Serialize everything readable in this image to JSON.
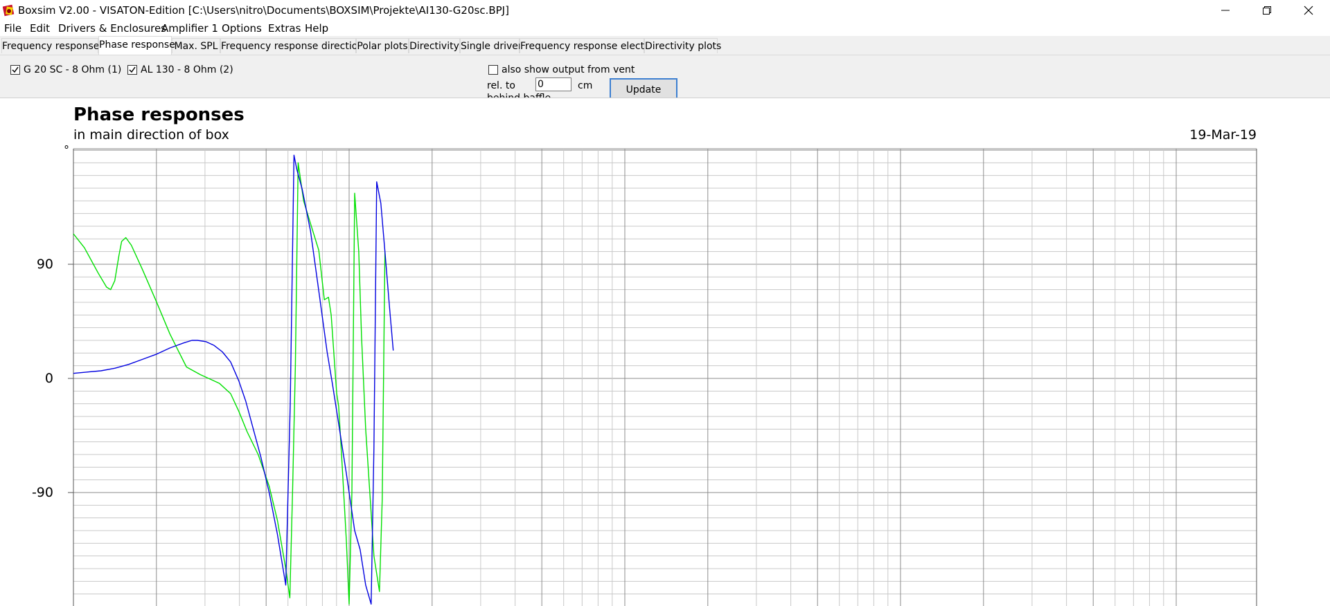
{
  "window": {
    "title": "Boxsim V2.00 - VISATON-Edition [C:\\Users\\nitro\\Documents\\BOXSIM\\Projekte\\AI130-G20sc.BPJ]",
    "icon": "boxsim-app-icon"
  },
  "menu": {
    "items": [
      "File",
      "Edit",
      "Drivers & Enclosures",
      "Amplifier 1",
      "Options",
      "Extras",
      "Help"
    ]
  },
  "tabs": [
    {
      "label": "Frequency response.",
      "active": false
    },
    {
      "label": "Phase response",
      "active": true
    },
    {
      "label": "Max. SPL",
      "active": false
    },
    {
      "label": "Frequency response directions",
      "active": false
    },
    {
      "label": "Polar plots",
      "active": false
    },
    {
      "label": "Directivity",
      "active": false
    },
    {
      "label": "Single driver",
      "active": false
    },
    {
      "label": "Frequency response electr..",
      "active": false
    },
    {
      "label": "Directivity plots",
      "active": false
    }
  ],
  "controls": {
    "driver1": {
      "label": "G 20 SC - 8 Ohm (1)",
      "checked": true
    },
    "driver2": {
      "label": "AL 130 - 8 Ohm (2)",
      "checked": true
    },
    "vent": {
      "label": "also show output from vent",
      "checked": false
    },
    "rel_to_label": "rel. to",
    "rel_to_value": "0",
    "unit_label": "cm",
    "behind_label": "behind baffle",
    "update_label": "Update graphs"
  },
  "chart_data": {
    "type": "line",
    "title": "Phase responses",
    "subtitle": "in main direction of box",
    "date": "19-Mar-19",
    "ylabel": "°",
    "yticks": [
      "90",
      "0",
      "-90"
    ],
    "ylim": [
      -178,
      180
    ],
    "xscale": "log",
    "xlim_decades": 3,
    "grid": true,
    "colors": {
      "G 20 SC - 8 Ohm (1)": "#00e000",
      "AL 130 - 8 Ohm (2)": "#0000e0"
    },
    "series": [
      {
        "name": "G 20 SC - 8 Ohm (1)",
        "color": "#00e000",
        "points": [
          [
            0,
            114
          ],
          [
            0.04,
            103
          ],
          [
            0.09,
            83
          ],
          [
            0.12,
            72
          ],
          [
            0.135,
            70
          ],
          [
            0.15,
            77
          ],
          [
            0.165,
            97
          ],
          [
            0.175,
            108
          ],
          [
            0.19,
            111
          ],
          [
            0.21,
            105
          ],
          [
            0.25,
            86
          ],
          [
            0.3,
            61
          ],
          [
            0.35,
            35
          ],
          [
            0.38,
            22
          ],
          [
            0.41,
            9
          ],
          [
            0.46,
            3
          ],
          [
            0.5,
            -1
          ],
          [
            0.53,
            -4
          ],
          [
            0.57,
            -12
          ],
          [
            0.6,
            -26
          ],
          [
            0.63,
            -42
          ],
          [
            0.67,
            -60
          ],
          [
            0.71,
            -85
          ],
          [
            0.74,
            -112
          ],
          [
            0.77,
            -150
          ],
          [
            0.785,
            -173
          ],
          [
            0.795,
            -88
          ],
          [
            0.805,
            10
          ],
          [
            0.815,
            170
          ],
          [
            0.835,
            140
          ],
          [
            0.86,
            122
          ],
          [
            0.89,
            101
          ],
          [
            0.91,
            62
          ],
          [
            0.925,
            64
          ],
          [
            0.935,
            50
          ],
          [
            0.95,
            3
          ],
          [
            0.955,
            -12
          ],
          [
            0.962,
            -22
          ],
          [
            0.975,
            -70
          ],
          [
            0.99,
            -128
          ],
          [
            1.0,
            -178
          ],
          [
            1.01,
            -90
          ],
          [
            1.02,
            146
          ],
          [
            1.035,
            100
          ],
          [
            1.045,
            33
          ],
          [
            1.06,
            -40
          ],
          [
            1.09,
            -140
          ],
          [
            1.11,
            -168
          ],
          [
            1.12,
            -95
          ],
          [
            1.13,
            100
          ]
        ]
      },
      {
        "name": "AL 130 - 8 Ohm (2)",
        "color": "#0000e0",
        "points": [
          [
            0,
            4
          ],
          [
            0.05,
            5
          ],
          [
            0.1,
            6
          ],
          [
            0.15,
            8
          ],
          [
            0.2,
            11
          ],
          [
            0.25,
            15
          ],
          [
            0.3,
            19
          ],
          [
            0.35,
            24
          ],
          [
            0.4,
            28
          ],
          [
            0.43,
            30
          ],
          [
            0.45,
            30
          ],
          [
            0.48,
            29
          ],
          [
            0.51,
            26
          ],
          [
            0.54,
            21
          ],
          [
            0.57,
            13
          ],
          [
            0.6,
            -2
          ],
          [
            0.625,
            -18
          ],
          [
            0.65,
            -38
          ],
          [
            0.68,
            -62
          ],
          [
            0.71,
            -90
          ],
          [
            0.74,
            -123
          ],
          [
            0.77,
            -163
          ],
          [
            0.7865,
            -20
          ],
          [
            0.8,
            176
          ],
          [
            0.81,
            165
          ],
          [
            0.83,
            149
          ],
          [
            0.86,
            116
          ],
          [
            0.89,
            69
          ],
          [
            0.92,
            21
          ],
          [
            0.94,
            -5
          ],
          [
            0.96,
            -33
          ],
          [
            0.99,
            -75
          ],
          [
            1.02,
            -120
          ],
          [
            1.04,
            -135
          ],
          [
            1.06,
            -163
          ],
          [
            1.08,
            -178
          ],
          [
            1.09,
            -55
          ],
          [
            1.1,
            155
          ],
          [
            1.115,
            138
          ],
          [
            1.13,
            100
          ],
          [
            1.145,
            60
          ],
          [
            1.16,
            22
          ]
        ]
      }
    ]
  }
}
